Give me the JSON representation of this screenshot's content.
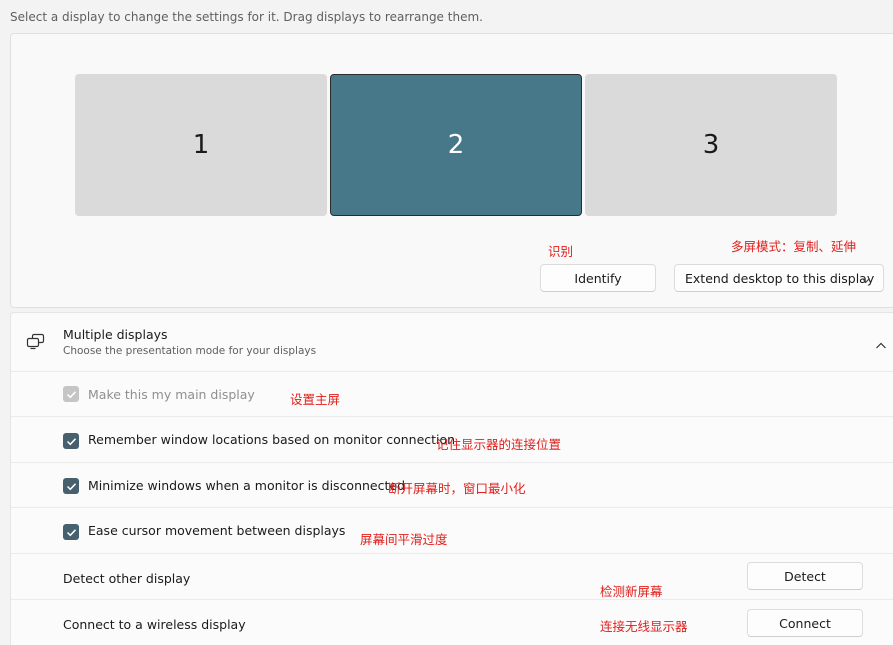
{
  "hint": "Select a display to change the settings for it. Drag displays to rearrange them.",
  "displays": [
    "1",
    "2",
    "3"
  ],
  "selected_display": "2",
  "identify_label": "Identify",
  "mode_select": {
    "value": "Extend desktop to this display"
  },
  "annotations": {
    "identify": "识别",
    "mode": "多屏模式：复制、延伸",
    "main": "设置主屏",
    "remember": "记住显示器的连接位置",
    "minimize": "断开屏幕时，窗口最小化",
    "ease": "屏幕间平滑过度",
    "detect": "检测新屏幕",
    "wireless": "连接无线显示器"
  },
  "multiple": {
    "title": "Multiple displays",
    "subtitle": "Choose the presentation mode for your displays"
  },
  "options": {
    "main": {
      "label": "Make this my main display",
      "checked": true,
      "disabled": true
    },
    "remember": {
      "label": "Remember window locations based on monitor connection",
      "checked": true
    },
    "minimize": {
      "label": "Minimize windows when a monitor is disconnected",
      "checked": true
    },
    "ease": {
      "label": "Ease cursor movement between displays",
      "checked": true
    }
  },
  "detect": {
    "label": "Detect other display",
    "button": "Detect"
  },
  "wireless": {
    "label": "Connect to a wireless display",
    "button": "Connect"
  },
  "colors": {
    "accent": "#47788a",
    "annotation": "#e0201c",
    "checkbox": "#47606e"
  }
}
